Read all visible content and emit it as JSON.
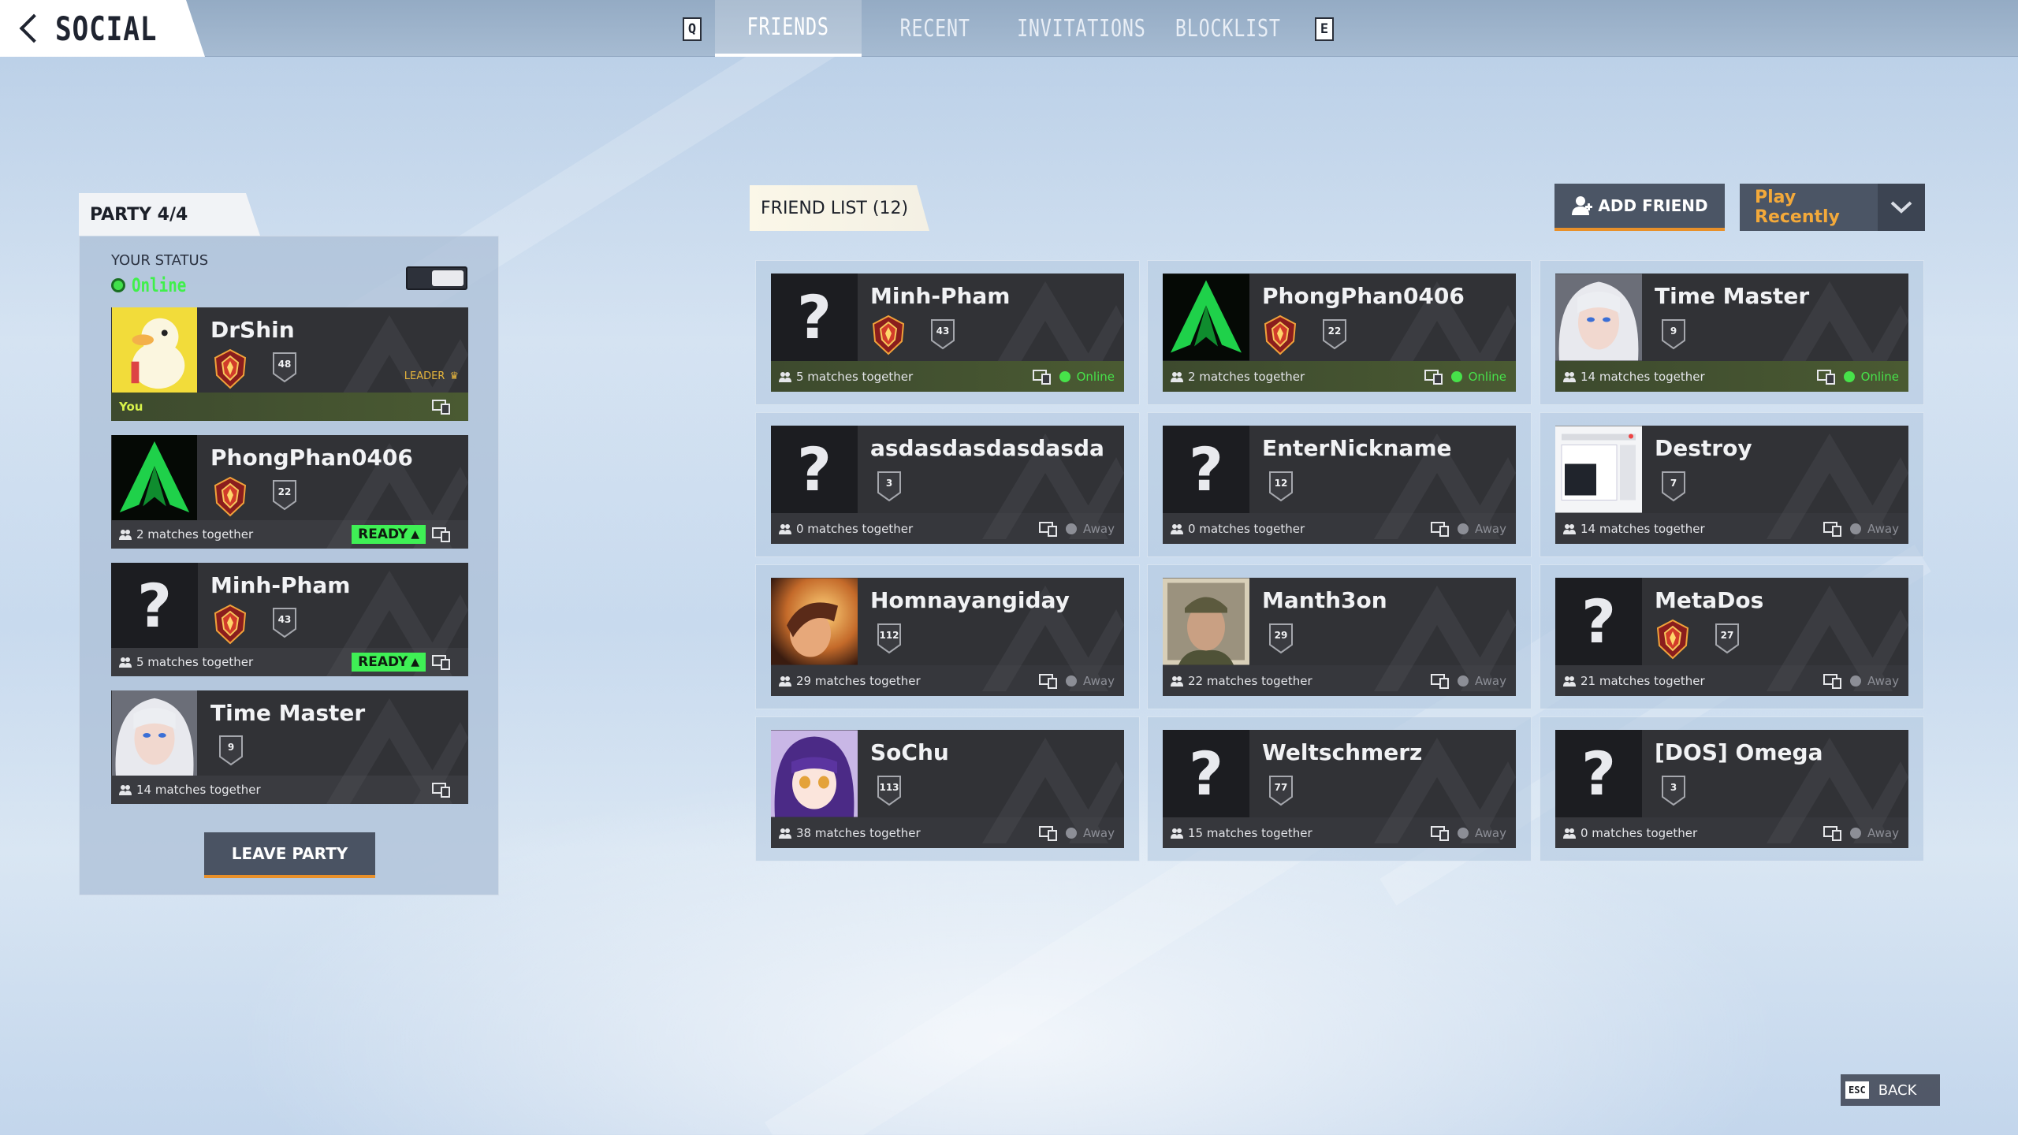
{
  "header": {
    "title": "SOCIAL",
    "key_left": "Q",
    "key_right": "E",
    "tabs": [
      {
        "label": "FRIENDS",
        "active": true
      },
      {
        "label": "RECENT",
        "active": false
      },
      {
        "label": "INVITATIONS",
        "active": false
      },
      {
        "label": "BLOCKLIST",
        "active": false
      }
    ]
  },
  "party": {
    "title": "PARTY 4/4",
    "your_status_label": "YOUR STATUS",
    "your_status_value": "Online",
    "leave_label": "LEAVE PARTY",
    "leader_label": "LEADER",
    "you_label": "You",
    "ready_label": "READY",
    "members": [
      {
        "name": "DrShin",
        "level": "48",
        "has_rank": true,
        "is_leader": true,
        "is_you": true,
        "matches": "",
        "ready": false,
        "avatar": "duck"
      },
      {
        "name": "PhongPhan0406",
        "level": "22",
        "has_rank": true,
        "is_leader": false,
        "is_you": false,
        "matches": "2 matches together",
        "ready": true,
        "avatar": "green-logo"
      },
      {
        "name": "Minh-Pham",
        "level": "43",
        "has_rank": true,
        "is_leader": false,
        "is_you": false,
        "matches": "5 matches together",
        "ready": true,
        "avatar": "unknown"
      },
      {
        "name": "Time Master",
        "level": "9",
        "has_rank": false,
        "is_leader": false,
        "is_you": false,
        "matches": "14 matches together",
        "ready": false,
        "avatar": "white-hair"
      }
    ]
  },
  "friend_list": {
    "title": "FRIEND LIST (12)",
    "add_friend_label": "ADD FRIEND",
    "sort_label": "Play Recently",
    "friends": [
      {
        "name": "Minh-Pham",
        "level": "43",
        "has_rank": true,
        "matches": "5 matches together",
        "status": "Online",
        "avatar": "unknown"
      },
      {
        "name": "PhongPhan0406",
        "level": "22",
        "has_rank": true,
        "matches": "2 matches together",
        "status": "Online",
        "avatar": "green-logo"
      },
      {
        "name": "Time Master",
        "level": "9",
        "has_rank": false,
        "matches": "14 matches together",
        "status": "Online",
        "avatar": "white-hair"
      },
      {
        "name": "asdasdasdasdasda",
        "level": "3",
        "has_rank": false,
        "matches": "0 matches together",
        "status": "Away",
        "avatar": "unknown"
      },
      {
        "name": "EnterNickname",
        "level": "12",
        "has_rank": false,
        "matches": "0 matches together",
        "status": "Away",
        "avatar": "unknown"
      },
      {
        "name": "Destroy",
        "level": "7",
        "has_rank": false,
        "matches": "14 matches together",
        "status": "Away",
        "avatar": "screenshot"
      },
      {
        "name": "Homnayangiday",
        "level": "112",
        "has_rank": false,
        "matches": "29 matches together",
        "status": "Away",
        "avatar": "warm"
      },
      {
        "name": "Manth3on",
        "level": "29",
        "has_rank": false,
        "matches": "22 matches together",
        "status": "Away",
        "avatar": "soldier"
      },
      {
        "name": "MetaDos",
        "level": "27",
        "has_rank": true,
        "matches": "21 matches together",
        "status": "Away",
        "avatar": "unknown"
      },
      {
        "name": "SoChu",
        "level": "113",
        "has_rank": false,
        "matches": "38 matches together",
        "status": "Away",
        "avatar": "anime"
      },
      {
        "name": "Weltschmerz",
        "level": "77",
        "has_rank": false,
        "matches": "15 matches together",
        "status": "Away",
        "avatar": "unknown"
      },
      {
        "name": "[DOS] Omega",
        "level": "3",
        "has_rank": false,
        "matches": "0 matches together",
        "status": "Away",
        "avatar": "unknown"
      }
    ]
  },
  "footer": {
    "back_key": "ESC",
    "back_label": "BACK"
  },
  "colors": {
    "online": "#47e24a",
    "away": "#8c8e96",
    "accent_orange": "#e8902a",
    "ready_green": "#3ff055"
  }
}
